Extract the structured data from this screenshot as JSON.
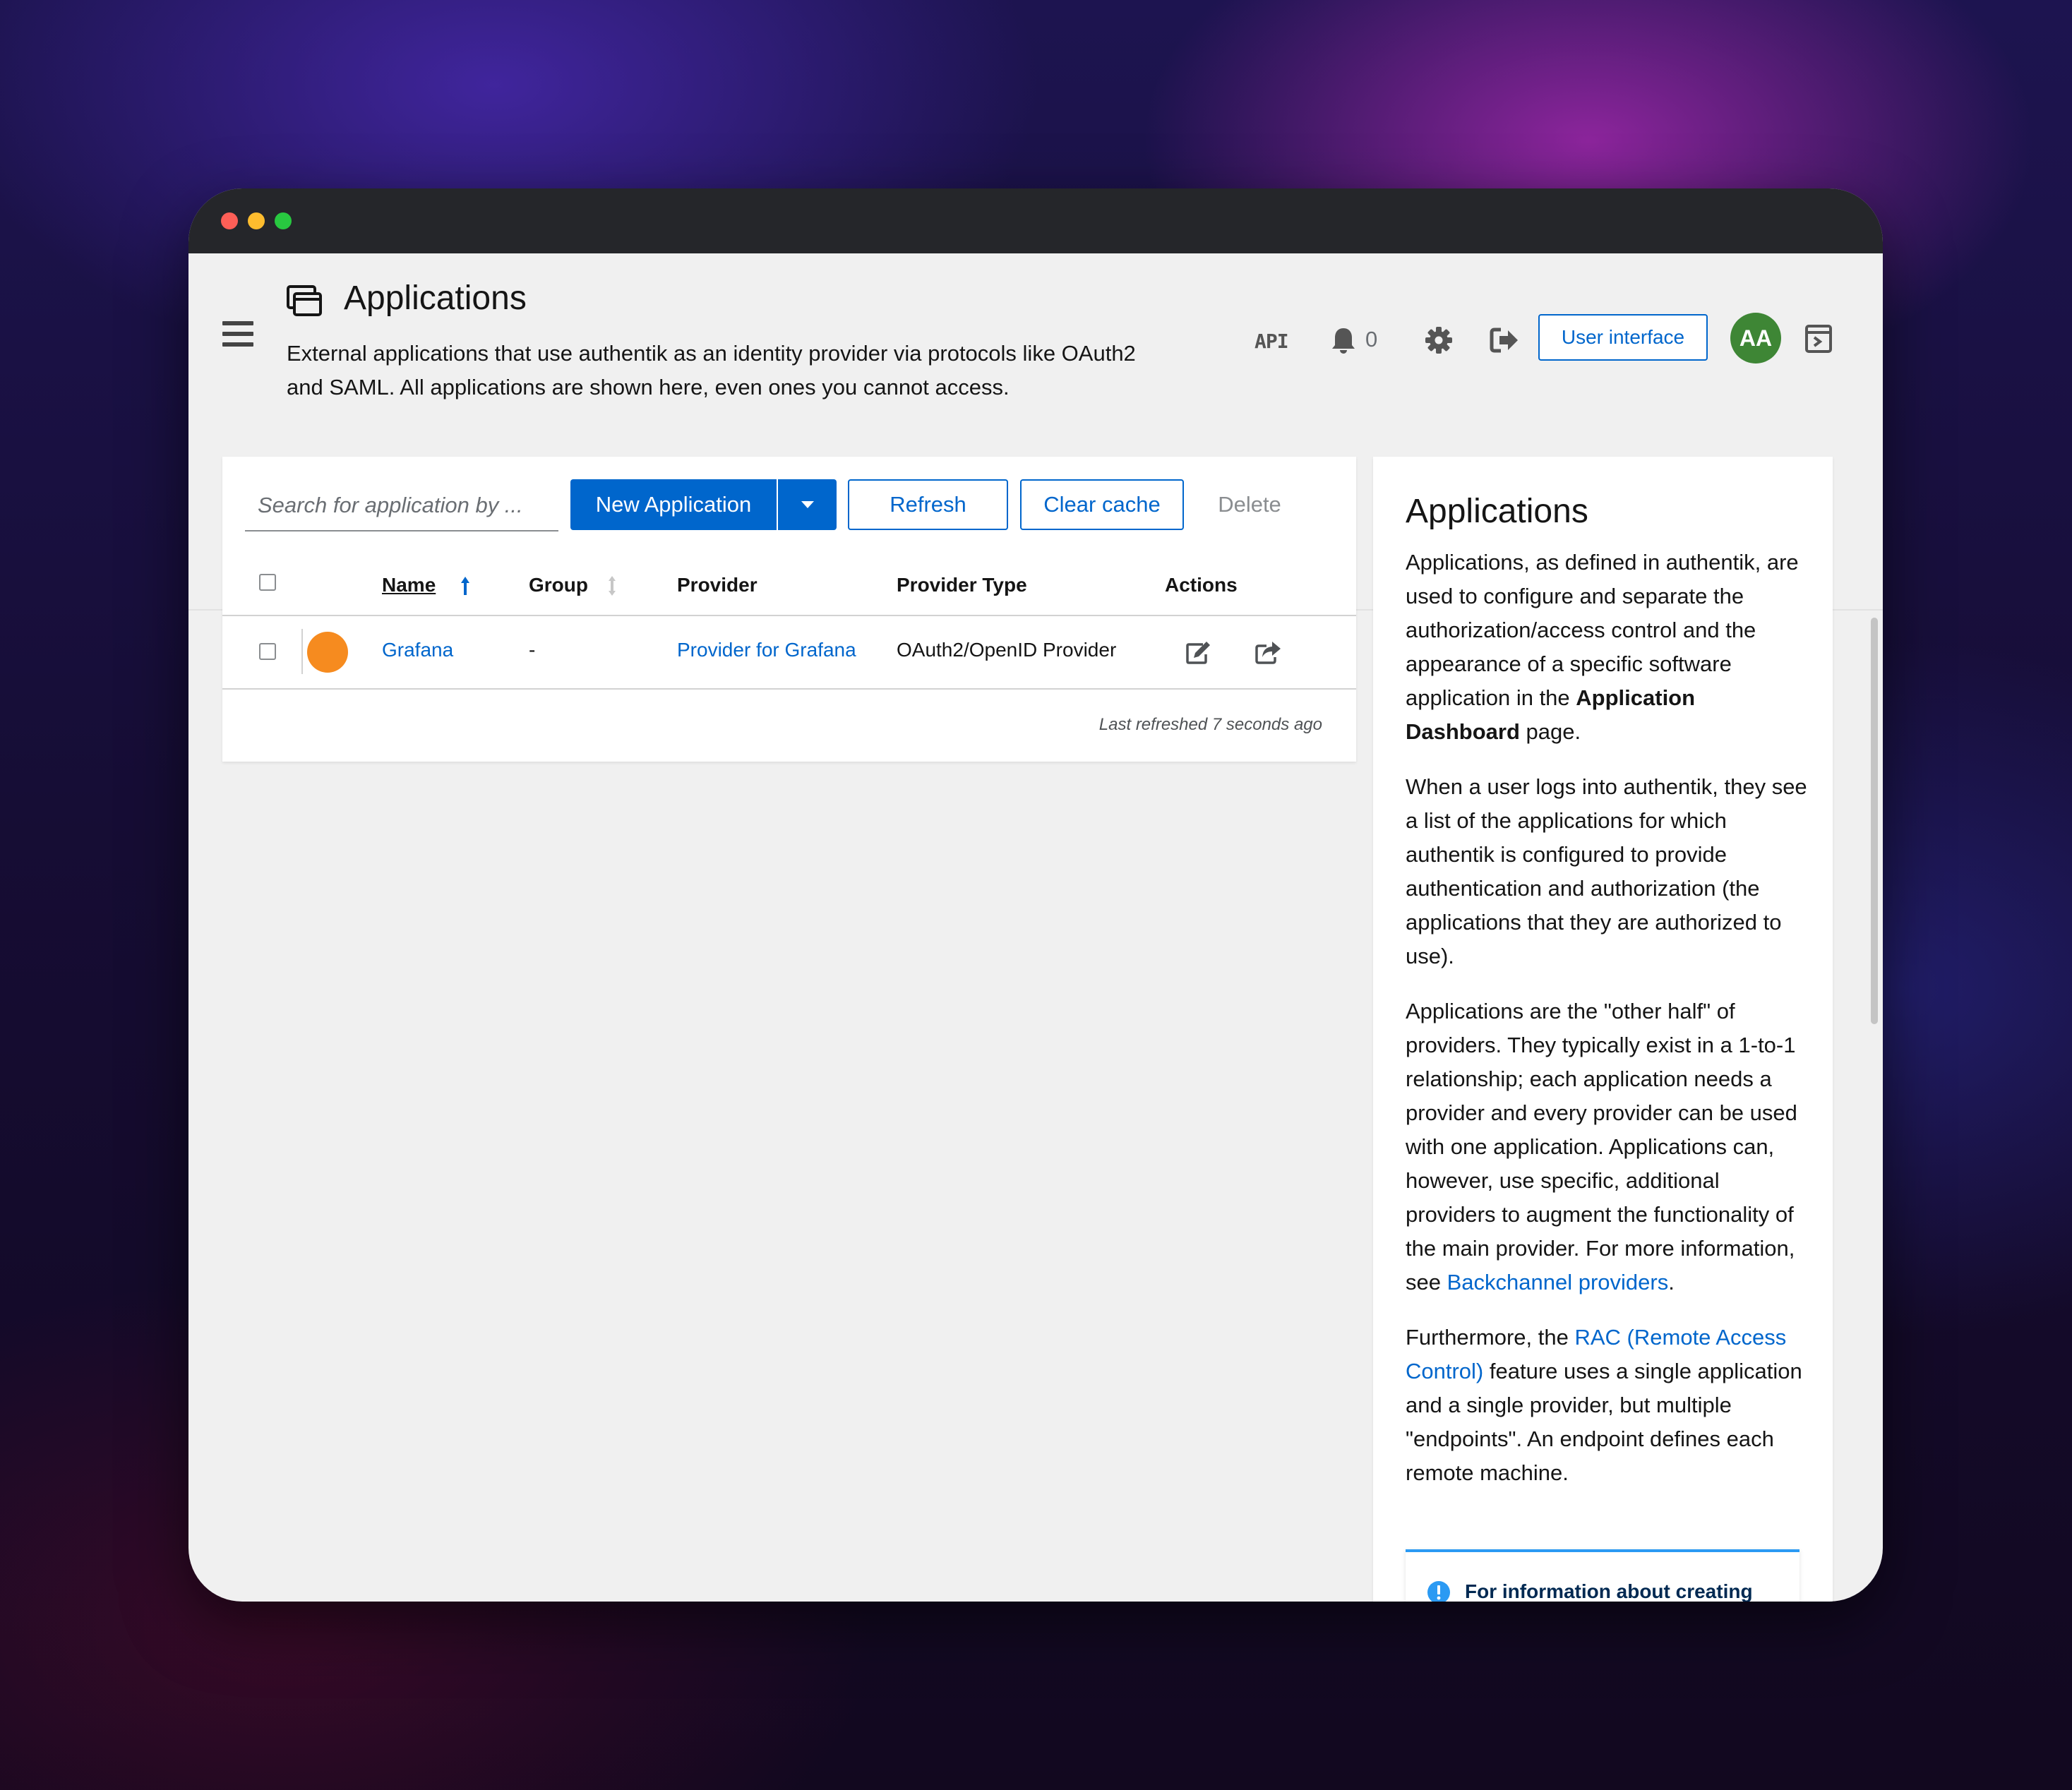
{
  "header": {
    "title": "Applications",
    "description": "External applications that use authentik as an identity provider via protocols like OAuth2 and SAML. All applications are shown here, even ones you cannot access.",
    "api_label": "API",
    "notification_count": "0",
    "user_interface_label": "User interface",
    "avatar_initials": "AA",
    "avatar_color": "#3e8635",
    "icons": [
      "menu-icon",
      "applications-icon",
      "bell-icon",
      "gear-icon",
      "logout-icon",
      "drawer-icon"
    ]
  },
  "toolbar": {
    "search_placeholder": "Search for application by ...",
    "new_application_label": "New Application",
    "refresh_label": "Refresh",
    "clear_cache_label": "Clear cache",
    "delete_label": "Delete"
  },
  "table": {
    "columns": {
      "name": "Name",
      "group": "Group",
      "provider": "Provider",
      "provider_type": "Provider Type",
      "actions": "Actions"
    },
    "rows": [
      {
        "name": "Grafana",
        "group": "-",
        "provider": "Provider for Grafana",
        "provider_type": "OAuth2/OpenID Provider",
        "logo_color": "#f68b1f"
      }
    ],
    "last_refreshed": "Last refreshed 7 seconds ago"
  },
  "sidebar": {
    "title": "Applications",
    "p1_a": "Applications, as defined in authentik, are used to configure and separate the authorization/access control and the appearance of a specific software application in the ",
    "p1_b": "Application Dashboard",
    "p1_c": " page.",
    "p2": "When a user logs into authentik, they see a list of the applications for which authentik is configured to provide authentication and authorization (the applications that they are authorized to use).",
    "p3_a": "Applications are the \"other half\" of providers. They typically exist in a 1-to-1 relationship; each application needs a provider and every provider can be used with one application. Applications can, however, use specific, additional providers to augment the functionality of the main provider. For more information, see ",
    "p3_link": "Backchannel providers",
    "p3_c": ".",
    "p4_a": "Furthermore, the ",
    "p4_link": "RAC (Remote Access Control)",
    "p4_c": " feature uses a single application and a single provider, but multiple \"endpoints\". An endpoint defines each remote machine.",
    "alert_title": "For information about creating"
  },
  "colors": {
    "primary": "#0066cc",
    "info": "#2b9af3"
  }
}
